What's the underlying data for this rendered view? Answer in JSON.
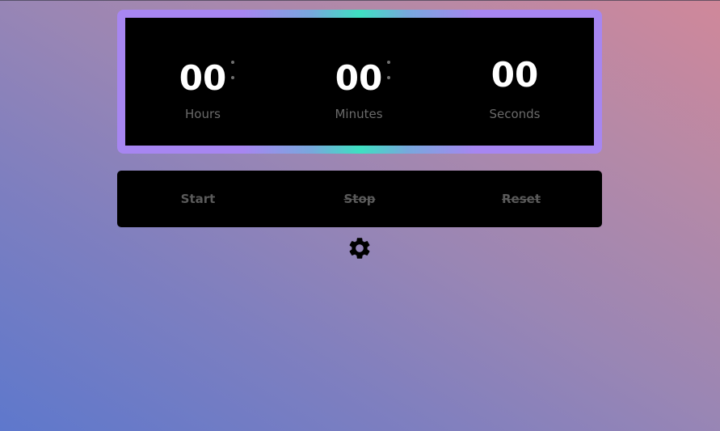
{
  "timer": {
    "hours": "00",
    "minutes": "00",
    "seconds": "00",
    "hours_label": "Hours",
    "minutes_label": "Minutes",
    "seconds_label": "Seconds"
  },
  "controls": {
    "start_label": "Start",
    "stop_label": "Stop",
    "reset_label": "Reset"
  },
  "settings": {
    "icon": "gear-icon"
  },
  "colors": {
    "frame_border": "#a786f1",
    "frame_accent": "#3ee0c1",
    "panel_background": "#000000",
    "digit_color": "#ffffff",
    "label_color": "#6a6a6a",
    "button_text_color": "#5a5a5a"
  }
}
